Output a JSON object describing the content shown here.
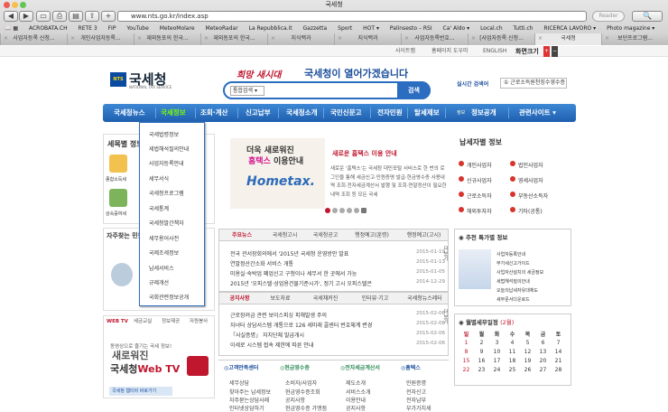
{
  "window": {
    "title": "국세청"
  },
  "toolbar": {
    "url": "www.nts.go.kr/index.asp",
    "reader": "Reader"
  },
  "bookmarks": [
    "ACROBATA.CH",
    "RETE 3",
    "FIP",
    "YouTube",
    "MeteoMolare",
    "MeteoRadar",
    "La Repubblica.it",
    "Gazzetta",
    "Sport",
    "HOT ▾",
    "Palinsesto – RSI",
    "Ca' Aldo ▾",
    "Local.ch",
    "Tutti.ch",
    "RICERCA LAVORO ▾",
    "Photo magazine ▾"
  ],
  "tabs": [
    "사업자등록 신청...",
    "개인사업자등록...",
    "재외동포의 한국...",
    "재외동포의 한국...",
    "지식백과",
    "지식백과",
    "사업자등록번호...",
    "[사업자등록 신청...",
    "국세청",
    "보던프로그램..."
  ],
  "util": {
    "sitemap": "사이트맵",
    "homepage": "홈페이지 도우미",
    "english": "ENGLISH",
    "fontsize": "화면크기"
  },
  "header": {
    "logo_mark": "NTS",
    "logo": "국세청",
    "logo_sub": "NATIONAL TAX SERVICE",
    "slogan_script": "희망 새시대",
    "slogan": "국세청이 열어가겠습니다",
    "search_select": "통합검색",
    "search_button": "검색",
    "realtime": "실시간 검색어",
    "nearby": "근로소득원천징수영수증"
  },
  "nav": [
    "국세청뉴스",
    "국세정보",
    "조회·계산",
    "신고납부",
    "국세청소개",
    "국민신문고",
    "전자민원",
    "탈세제보",
    "정보공개",
    "관련사이트 ▾"
  ],
  "nav_tag": "정보",
  "dropdown": [
    "국세법령정보",
    "세법해석질의안내",
    "사업자등록안내",
    "세무서식",
    "국세청프로그램",
    "국세통계",
    "국세청발간책자",
    "세무용어사전",
    "국제조세정보",
    "납세서비스",
    "규제개선",
    "국회관련정보공개"
  ],
  "sidebar": {
    "title": "세목별 정보",
    "items": [
      "종합소득세",
      "양도소득세",
      "상속증여세"
    ],
    "faq_title": "자주찾는 민원",
    "tabs": [
      "WEB TV",
      "세금교실",
      "정보제공",
      "자원봉사"
    ],
    "tv_small": "동영상으로 즐기는 국세 정보!",
    "tv_big1": "새로워진",
    "tv_big2": "국세청",
    "tv_big3": "Web TV",
    "tv_link": "국세청 웹티비 바로가기"
  },
  "banner": {
    "line1": "더욱 새로워진",
    "line2a": "홈택스",
    "line2b": "이용안내",
    "logo": "Hometax.",
    "title": "새로운 홈택스 이용 안내",
    "body": "새로운 '홈택스'는 국세청 대민포털 서비스로 한 번의 로그인을 통해 세금신고·민원증명 발급·현금영수증 사용내역 조회·전자세금계산서 발행 및 조회·연말정산이 필요한 내역 조회 등 모든 국세"
  },
  "news": {
    "tabs": [
      "주요뉴스",
      "국세청고시",
      "국세청공고",
      "행정예고(훈령)",
      "행정예고(고시)"
    ],
    "rows": [
      {
        "text": "2015년 국세청 운영방안 발표",
        "prefix": "전국 관서장회의에서 '",
        "suffix": "",
        "date": "2015-01-19"
      },
      {
        "text": "연말정산간소화 서비스 개통",
        "prefix": "",
        "suffix": "",
        "date": "2015-01-13"
      },
      {
        "text": "미용실·숙박업 폐업신고 구청이나 세무서 한 곳에서 가능",
        "prefix": "",
        "suffix": "",
        "date": "2015-01-05"
      },
      {
        "text": "2015년 '오피스텔·상업용건물기준시가', 정기 고시 오피스텔은",
        "prefix": "",
        "suffix": "",
        "date": "2014-12-29"
      }
    ],
    "more": "더보기"
  },
  "notice": {
    "tabs": [
      "공지사항",
      "보도자료",
      "국세채커진",
      "인터뷰·기고",
      "국세청뉴스레터"
    ],
    "rows": [
      {
        "text": "근로장려금 관련 보이스피싱 피해발생 주의",
        "date": "2015-02-06"
      },
      {
        "text": "자녀터 상담서스템 개통으로 126 세미래 콜센터 번호체계 변경",
        "date": "2015-02-06"
      },
      {
        "text": "「사실증명」 자치단체 발급개시",
        "date": "2015-02-06"
      },
      {
        "text": "이세로 시스템 접속 제한에 따른 안내",
        "date": "2015-02-06"
      }
    ],
    "more": "더보기"
  },
  "links": [
    {
      "head": "고객만족센터",
      "items": [
        "세무상담",
        "찾아주는 납세정보",
        "자주묻는상담사례",
        "인터넷상담하기"
      ]
    },
    {
      "head": "현금영수증",
      "items": [
        "소비자/사업자",
        "현금영수증조회",
        "공지사항",
        "현금영수증 가맹점"
      ]
    },
    {
      "head": "전자세금계산서",
      "items": [
        "제도소개",
        "서비스소개",
        "이용안내",
        "공지사항"
      ]
    },
    {
      "head": "홈택스",
      "items": [
        "민원증명",
        "전자신고",
        "전자납부",
        "부가가치세"
      ]
    }
  ],
  "right": {
    "title": "납세자별 정보",
    "items": [
      "개인사업자",
      "법인사업자",
      "신규사업자",
      "영세사업자",
      "근로소득자",
      "부동산소득자",
      "해외투자자",
      "기타(공통)"
    ],
    "recommend_title": "추천 특가별 정보",
    "recommend": [
      "사업자등록안내",
      "부가세신고가이드",
      "사업자산설치의 세금정보",
      "세법해석질의안내",
      "오늘의납세자유대체도",
      "세무문서다운로드"
    ],
    "calendar_title": "월별세무일정",
    "calendar_month": "(2월)",
    "weekdays": [
      "일",
      "월",
      "화",
      "수",
      "목",
      "금",
      "토"
    ],
    "days": [
      "1",
      "2",
      "3",
      "4",
      "5",
      "6",
      "7",
      "8",
      "9",
      "10",
      "11",
      "12",
      "13",
      "14",
      "15",
      "16",
      "17",
      "18",
      "19",
      "20",
      "21",
      "22",
      "23",
      "24",
      "25",
      "26",
      "27",
      "28"
    ]
  },
  "colors": {
    "accent": "#2b6dc0",
    "red": "#c0172f",
    "nav_active": "#7CFC00"
  }
}
